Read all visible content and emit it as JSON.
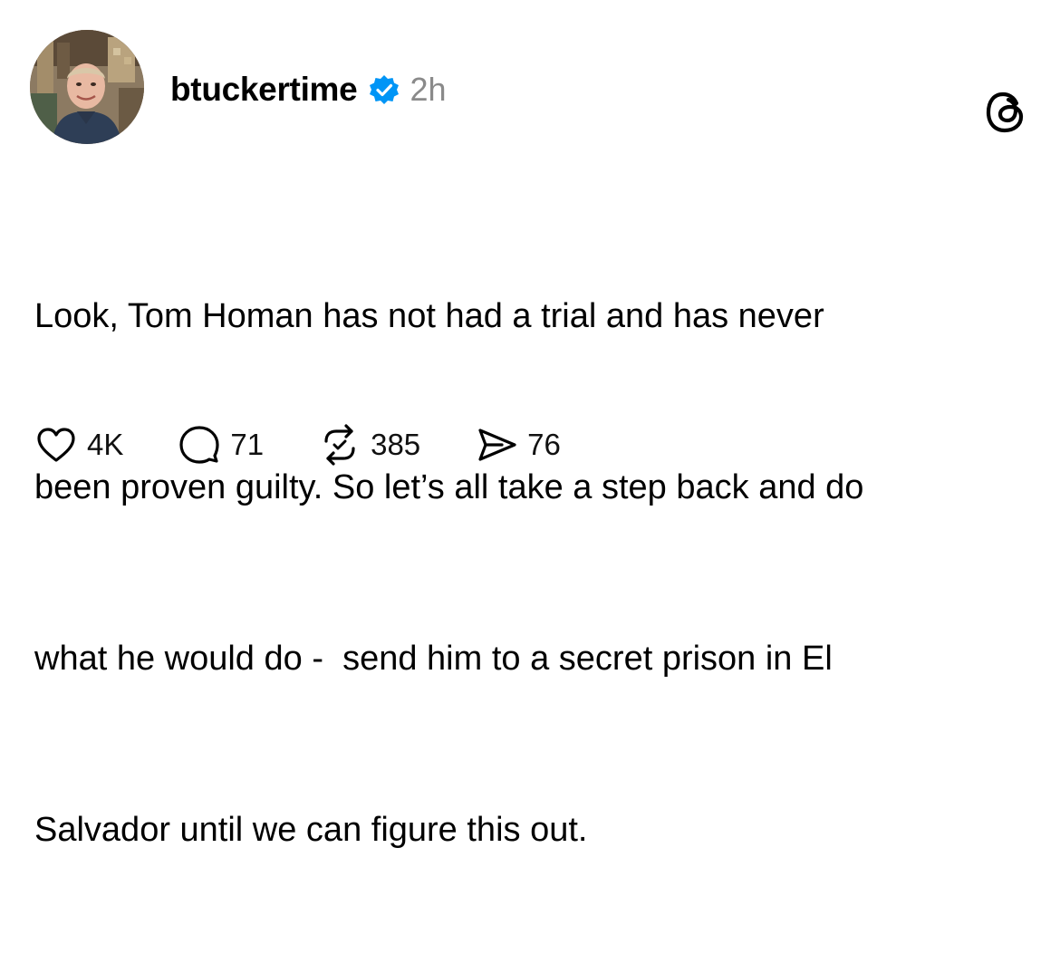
{
  "post": {
    "author": {
      "username": "btuckertime",
      "verified": true,
      "avatar_icon": "profile-photo",
      "verified_icon": "verified-badge-icon",
      "verified_color": "#0095f6"
    },
    "timestamp": "2h",
    "app_icon": "threads-logo-icon",
    "text_lines": [
      "Look, Tom Homan has not had a trial and has never",
      "been proven guilty. So let’s all take a step back and do",
      "what he would do -  send him to a secret prison in El",
      "Salvador until we can figure this out."
    ],
    "actions": {
      "likes": {
        "icon": "heart-icon",
        "count": "4K"
      },
      "replies": {
        "icon": "comment-icon",
        "count": "71"
      },
      "reposts": {
        "icon": "repost-icon",
        "count": "385"
      },
      "shares": {
        "icon": "share-icon",
        "count": "76"
      }
    }
  }
}
